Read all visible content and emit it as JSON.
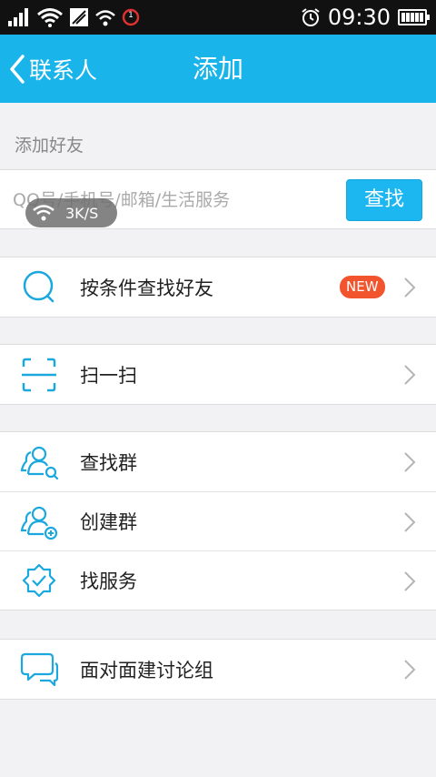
{
  "status_bar": {
    "time": "09:30",
    "notif_badge": "1"
  },
  "nav": {
    "back_label": "联系人",
    "title": "添加"
  },
  "add_friend": {
    "section_label": "添加好友",
    "search_placeholder": "QQ号/手机号/邮箱/生活服务",
    "search_button": "查找"
  },
  "speed_toast": {
    "text": "3K/S"
  },
  "menu": {
    "find_by_condition": {
      "label": "按条件查找好友",
      "badge": "NEW"
    },
    "scan": {
      "label": "扫一扫"
    },
    "find_group": {
      "label": "查找群"
    },
    "create_group": {
      "label": "创建群"
    },
    "find_service": {
      "label": "找服务"
    },
    "face_to_face": {
      "label": "面对面建讨论组"
    }
  },
  "colors": {
    "accent": "#19b4ea",
    "badge": "#f2542d",
    "icon": "#1aa8de"
  }
}
